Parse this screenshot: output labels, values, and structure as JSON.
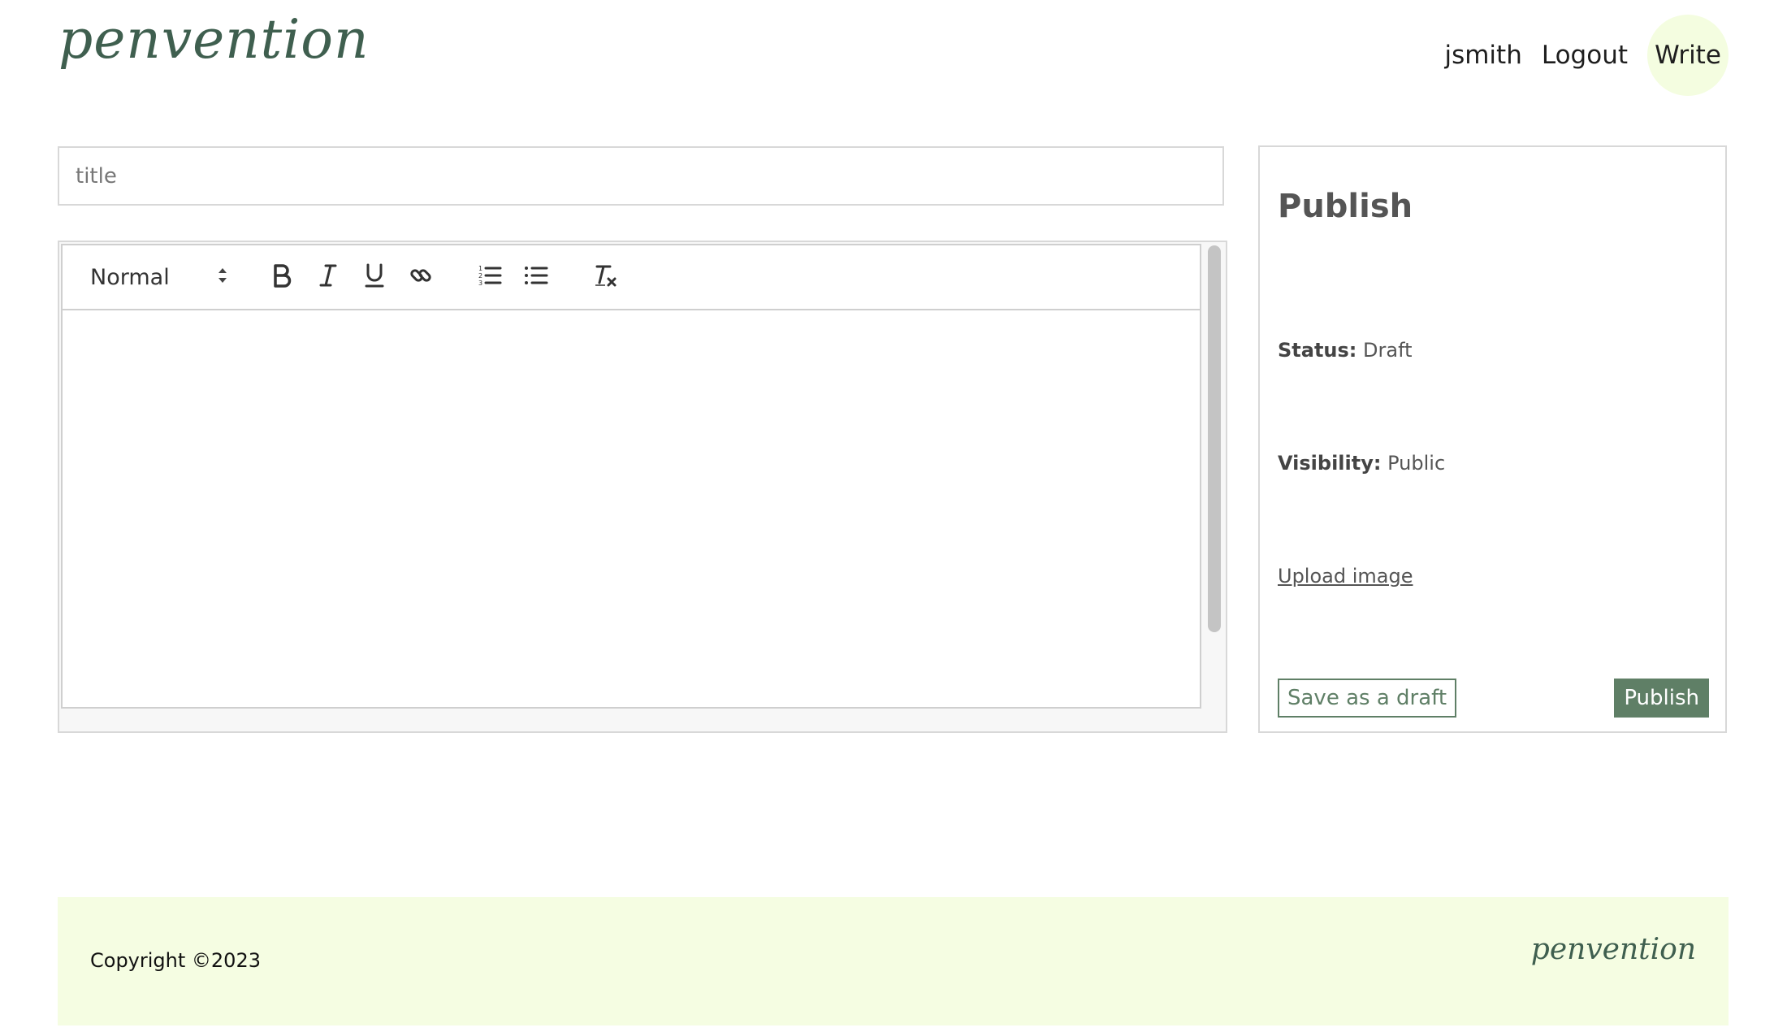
{
  "header": {
    "logo": "penvention",
    "nav": {
      "username": "jsmith",
      "logout": "Logout",
      "write": "Write"
    }
  },
  "editor": {
    "title_placeholder": "title",
    "format_select": "Normal",
    "toolbar_icons": [
      "bold-icon",
      "italic-icon",
      "underline-icon",
      "link-icon",
      "ordered-list-icon",
      "bullet-list-icon",
      "clear-format-icon"
    ]
  },
  "publish_panel": {
    "heading": "Publish",
    "status_label": "Status:",
    "status_value": "Draft",
    "visibility_label": "Visibility:",
    "visibility_value": "Public",
    "upload_label": "Upload image",
    "save_draft_label": "Save as a draft",
    "publish_label": "Publish"
  },
  "footer": {
    "copyright": "Copyright ©2023",
    "logo": "penvention"
  },
  "colors": {
    "brand_green": "#5f7f66",
    "logo_green": "#3f5f4f",
    "accent_light": "#f5fde2"
  }
}
